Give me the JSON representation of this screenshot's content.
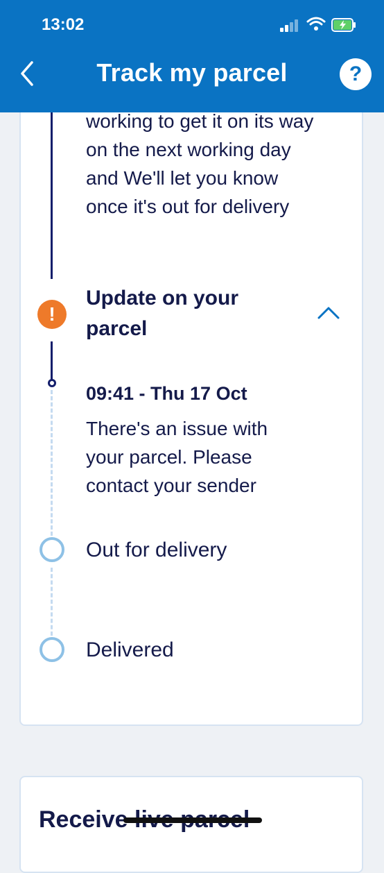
{
  "status_bar": {
    "time": "13:02"
  },
  "header": {
    "title": "Track my parcel",
    "help_label": "?"
  },
  "timeline": {
    "previous_text": "working to get it on its way on the next working day and We'll let you know once it's out for delivery",
    "update_heading": "Update on your parcel",
    "event_time": "09:41 - Thu 17 Oct",
    "event_message": "There's an issue with your parcel. Please contact your sender",
    "step_out_for_delivery": "Out for delivery",
    "step_delivered": "Delivered"
  },
  "next_card": {
    "heading": "Receive live parcel"
  },
  "colors": {
    "brand": "#0a73c3",
    "alert": "#ee7a2a",
    "navy": "#141e6b",
    "pending": "#8ec1e6"
  }
}
